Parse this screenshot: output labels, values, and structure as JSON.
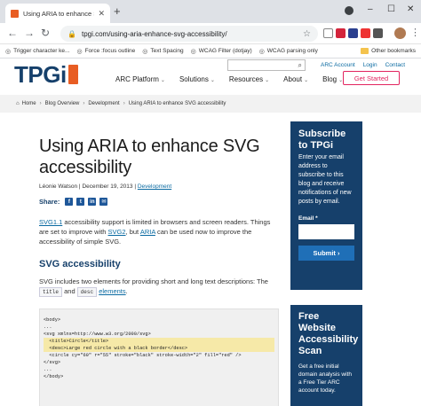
{
  "browser": {
    "tab_title": "Using ARIA to enhance SVG acc",
    "url": "tpgi.com/using-aria-enhance-svg-accessibility/",
    "bookmarks": [
      "Trigger character ke...",
      "Force :focus outline",
      "Text Spacing",
      "WCAG Filter (dotjay)",
      "WCAG parsing only"
    ],
    "other_bookmarks": "Other bookmarks"
  },
  "site": {
    "logo_text": "TPGi",
    "utility_links": [
      "ARC Account",
      "Login",
      "Contact"
    ],
    "nav": [
      "ARC Platform",
      "Solutions",
      "Resources",
      "About",
      "Blog"
    ],
    "cta": "Get Started",
    "breadcrumb": [
      "Home",
      "Blog Overview",
      "Development",
      "Using ARIA to enhance SVG accessibility"
    ]
  },
  "article": {
    "title": "Using ARIA to enhance SVG accessibility",
    "author": "Léonie Watson",
    "date": "December 19, 2013",
    "category": "Development",
    "share_label": "Share:",
    "intro": {
      "link1": "SVG1.1",
      "text1": " accessibility support is limited in browsers and screen readers. Things are set to improve with ",
      "link2": "SVG2",
      "text2": ", but ",
      "link3": "ARIA",
      "text3": " can be used now to improve the accessibility of simple SVG."
    },
    "h2": "SVG accessibility",
    "para2": {
      "text1": "SVG includes two elements for providing short and long text descriptions: The ",
      "code1": "title",
      "and": " and ",
      "code2": "desc",
      "link": "elements",
      "end": "."
    },
    "code_lines": [
      "<body>",
      "...",
      "<svg xmlns=http://www.w3.org/2000/svg>",
      "  <title>Circle</title>",
      "  <desc>Large red circle with a black border</desc>",
      "  <circle cy=\"60\" r=\"55\" stroke=\"black\" stroke-width=\"2\" fill=\"red\" />",
      "</svg>",
      "...",
      "</body>"
    ]
  },
  "sidebar_subscribe": {
    "heading": "Subscribe to TPGi",
    "body": "Enter your email address to subscribe to this blog and receive notifications of new posts by email.",
    "email_label": "Email *",
    "submit": "Submit ›"
  },
  "sidebar_scan": {
    "heading": "Free Website Accessibility Scan",
    "body": "Get a free initial domain analysis with a Free Tier ARC account today."
  },
  "colors": {
    "brand_navy": "#16406b",
    "brand_orange": "#e85d23",
    "cta_pink": "#e2245f",
    "link_blue": "#0a6aa1"
  }
}
